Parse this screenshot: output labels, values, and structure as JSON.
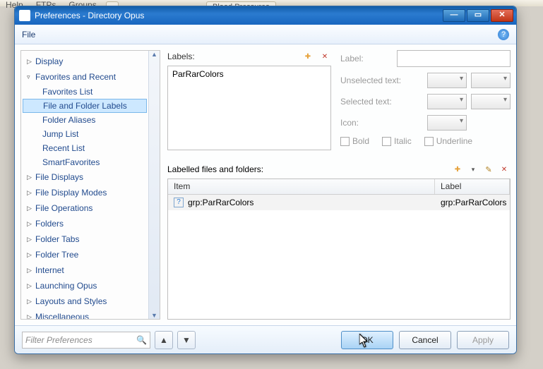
{
  "bg_menu": {
    "help": "Help",
    "ftps": "FTPs",
    "groups": "Groups"
  },
  "bg_tabs": {
    "a": "",
    "b": "Blood Pressures"
  },
  "window": {
    "title": "Preferences - Directory Opus",
    "file_menu": "File"
  },
  "tree": {
    "display": "Display",
    "fav_recent": "Favorites and Recent",
    "fav_list": "Favorites List",
    "file_folder_labels": "File and Folder Labels",
    "folder_aliases": "Folder Aliases",
    "jump_list": "Jump List",
    "recent_list": "Recent List",
    "smart_fav": "SmartFavorites",
    "file_displays": "File Displays",
    "file_display_modes": "File Display Modes",
    "file_operations": "File Operations",
    "folders": "Folders",
    "folder_tabs": "Folder Tabs",
    "folder_tree": "Folder Tree",
    "internet": "Internet",
    "launching": "Launching Opus",
    "layouts": "Layouts and Styles",
    "misc": "Miscellaneous"
  },
  "labels_section": {
    "heading": "Labels:",
    "list": {
      "item0": "ParRarColors"
    }
  },
  "label_form": {
    "label": "Label:",
    "unselected": "Unselected text:",
    "selected": "Selected text:",
    "icon": "Icon:",
    "bold": "Bold",
    "italic": "Italic",
    "underline": "Underline",
    "label_value": ""
  },
  "lff": {
    "heading": "Labelled files and folders:",
    "col_item": "Item",
    "col_label": "Label",
    "row0_item": "grp:ParRarColors",
    "row0_label": "grp:ParRarColors"
  },
  "bottom": {
    "filter_placeholder": "Filter Preferences",
    "ok": "OK",
    "cancel": "Cancel",
    "apply": "Apply"
  }
}
